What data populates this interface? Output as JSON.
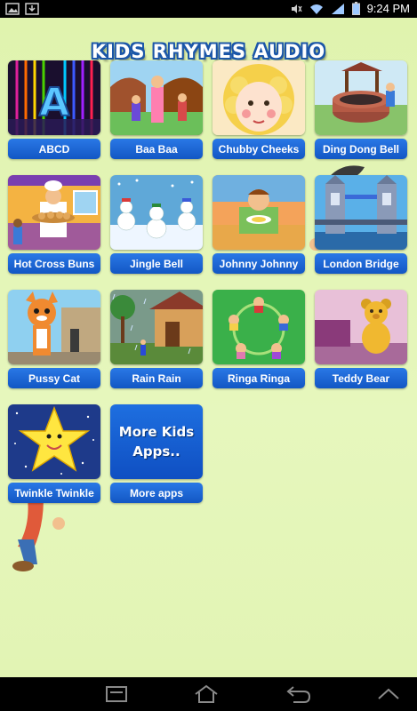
{
  "status": {
    "time": "9:24 PM",
    "left_icons": [
      "image-icon",
      "download-icon"
    ],
    "right_icons": [
      "mute-icon",
      "wifi-icon",
      "signal-icon",
      "battery-icon"
    ]
  },
  "app": {
    "title": "KIDS RHYMES AUDIO"
  },
  "rhymes": [
    {
      "label": "ABCD",
      "thumb": "abcd"
    },
    {
      "label": "Baa Baa",
      "thumb": "baa-baa"
    },
    {
      "label": "Chubby Cheeks",
      "thumb": "chubby-cheeks"
    },
    {
      "label": "Ding Dong Bell",
      "thumb": "ding-dong-bell"
    },
    {
      "label": "Hot Cross Buns",
      "thumb": "hot-cross-buns"
    },
    {
      "label": "Jingle Bell",
      "thumb": "jingle-bell"
    },
    {
      "label": "Johnny Johnny",
      "thumb": "johnny-johnny"
    },
    {
      "label": "London Bridge",
      "thumb": "london-bridge"
    },
    {
      "label": "Pussy Cat",
      "thumb": "pussy-cat"
    },
    {
      "label": "Rain Rain",
      "thumb": "rain-rain"
    },
    {
      "label": "Ringa Ringa",
      "thumb": "ringa-ringa"
    },
    {
      "label": "Teddy Bear",
      "thumb": "teddy-bear"
    },
    {
      "label": "Twinkle Twinkle",
      "thumb": "twinkle-twinkle"
    }
  ],
  "more_apps": {
    "thumb_line1": "More Kids",
    "thumb_line2": "Apps..",
    "label": "More apps"
  },
  "nav": {
    "icons": [
      "recent-apps-icon",
      "home-icon",
      "back-icon",
      "menu-up-icon"
    ]
  }
}
